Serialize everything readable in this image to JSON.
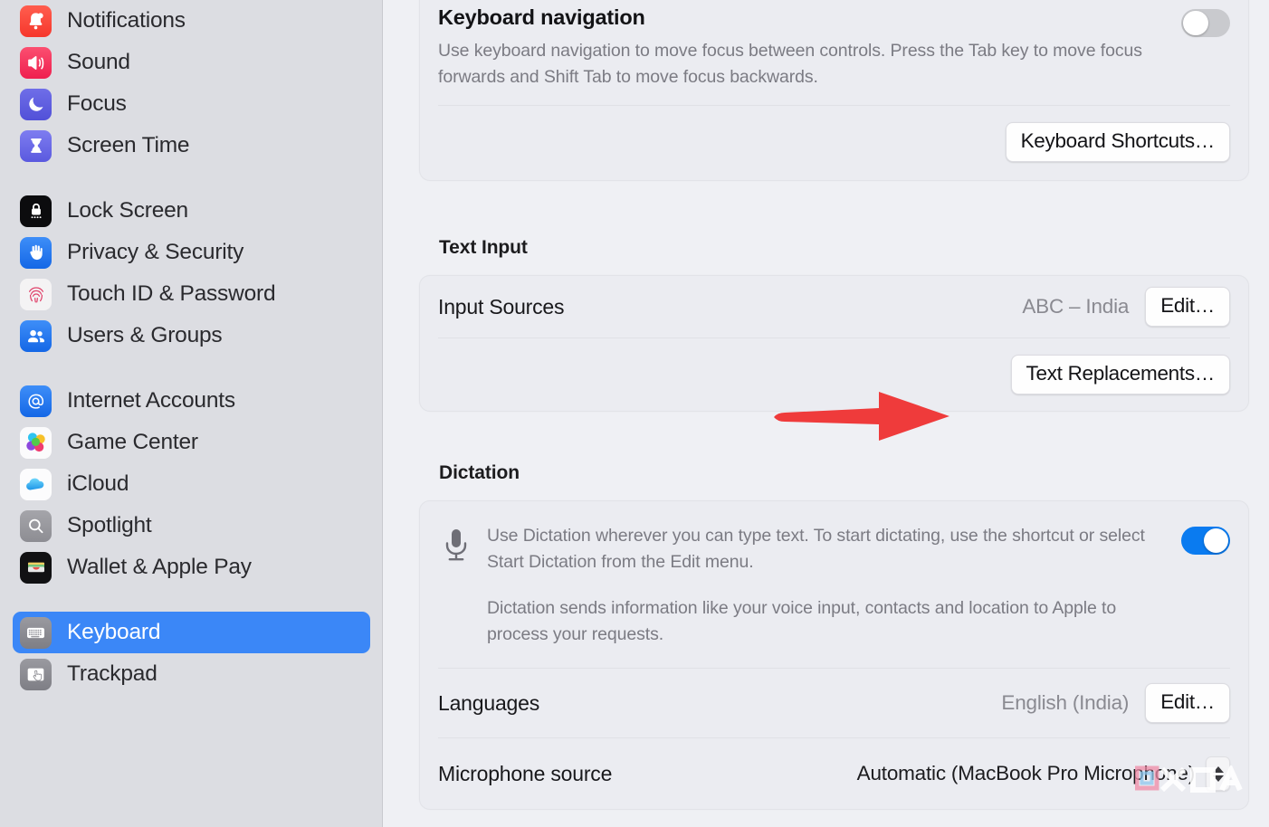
{
  "sidebar": {
    "groups": [
      {
        "items": [
          {
            "label": "Notifications",
            "icon": "notifications-icon"
          },
          {
            "label": "Sound",
            "icon": "sound-icon"
          },
          {
            "label": "Focus",
            "icon": "focus-icon"
          },
          {
            "label": "Screen Time",
            "icon": "screen-time-icon"
          }
        ]
      },
      {
        "items": [
          {
            "label": "Lock Screen",
            "icon": "lock-screen-icon"
          },
          {
            "label": "Privacy & Security",
            "icon": "privacy-security-icon"
          },
          {
            "label": "Touch ID & Password",
            "icon": "touch-id-icon"
          },
          {
            "label": "Users & Groups",
            "icon": "users-groups-icon"
          }
        ]
      },
      {
        "items": [
          {
            "label": "Internet Accounts",
            "icon": "internet-accounts-icon"
          },
          {
            "label": "Game Center",
            "icon": "game-center-icon"
          },
          {
            "label": "iCloud",
            "icon": "icloud-icon"
          },
          {
            "label": "Spotlight",
            "icon": "spotlight-icon"
          },
          {
            "label": "Wallet & Apple Pay",
            "icon": "wallet-icon"
          }
        ]
      },
      {
        "items": [
          {
            "label": "Keyboard",
            "icon": "keyboard-icon",
            "selected": true
          },
          {
            "label": "Trackpad",
            "icon": "trackpad-icon"
          }
        ]
      }
    ],
    "selection_color": "#3b87f7"
  },
  "main": {
    "keyboard_navigation": {
      "title": "Keyboard navigation",
      "description": "Use keyboard navigation to move focus between controls. Press the Tab key to move focus forwards and Shift Tab to move focus backwards.",
      "toggle_state": "off",
      "shortcuts_button": "Keyboard Shortcuts…"
    },
    "text_input": {
      "section_title": "Text Input",
      "input_sources_label": "Input Sources",
      "input_sources_value": "ABC – India",
      "input_sources_edit_button": "Edit…",
      "text_replacements_button": "Text Replacements…"
    },
    "dictation": {
      "section_title": "Dictation",
      "description_1": "Use Dictation wherever you can type text. To start dictating, use the shortcut or select Start Dictation from the Edit menu.",
      "description_2": "Dictation sends information like your voice input, contacts and location to Apple to process your requests.",
      "toggle_state": "on",
      "languages_label": "Languages",
      "languages_value": "English (India)",
      "languages_edit_button": "Edit…",
      "microphone_label": "Microphone source",
      "microphone_value": "Automatic (MacBook Pro Microphone)"
    }
  },
  "annotation": {
    "arrow_color": "#ef3b3b",
    "points_to": "Text Replacements…"
  },
  "watermark": {
    "text": "XDA"
  }
}
